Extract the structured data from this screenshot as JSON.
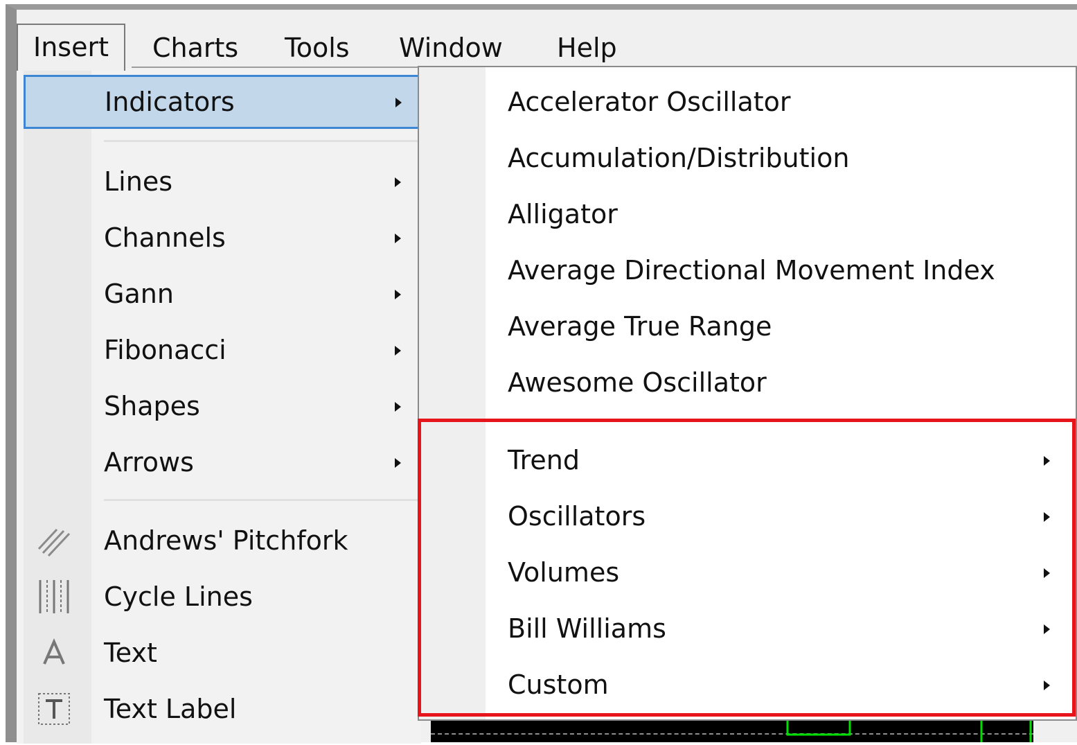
{
  "menubar": {
    "items": [
      "Insert",
      "Charts",
      "Tools",
      "Window",
      "Help"
    ]
  },
  "insert_menu": {
    "highlighted": "Indicators",
    "group1": [
      "Indicators"
    ],
    "group2": [
      "Lines",
      "Channels",
      "Gann",
      "Fibonacci",
      "Shapes",
      "Arrows"
    ],
    "group3": [
      {
        "label": "Andrews' Pitchfork",
        "icon": "pitchfork-icon"
      },
      {
        "label": "Cycle Lines",
        "icon": "cycle-lines-icon"
      },
      {
        "label": "Text",
        "icon": "text-icon"
      },
      {
        "label": "Text Label",
        "icon": "text-label-icon"
      }
    ]
  },
  "indicators_submenu": {
    "items": [
      "Accelerator Oscillator",
      "Accumulation/Distribution",
      "Alligator",
      "Average Directional Movement Index",
      "Average True Range",
      "Awesome Oscillator"
    ],
    "categories": [
      "Trend",
      "Oscillators",
      "Volumes",
      "Bill Williams",
      "Custom"
    ],
    "highlight_color": "#e8141c"
  },
  "colors": {
    "selection_fill": "#c3d7ea",
    "selection_border": "#3d86d4",
    "chart_background": "#000000",
    "chart_line": "#00e000"
  }
}
